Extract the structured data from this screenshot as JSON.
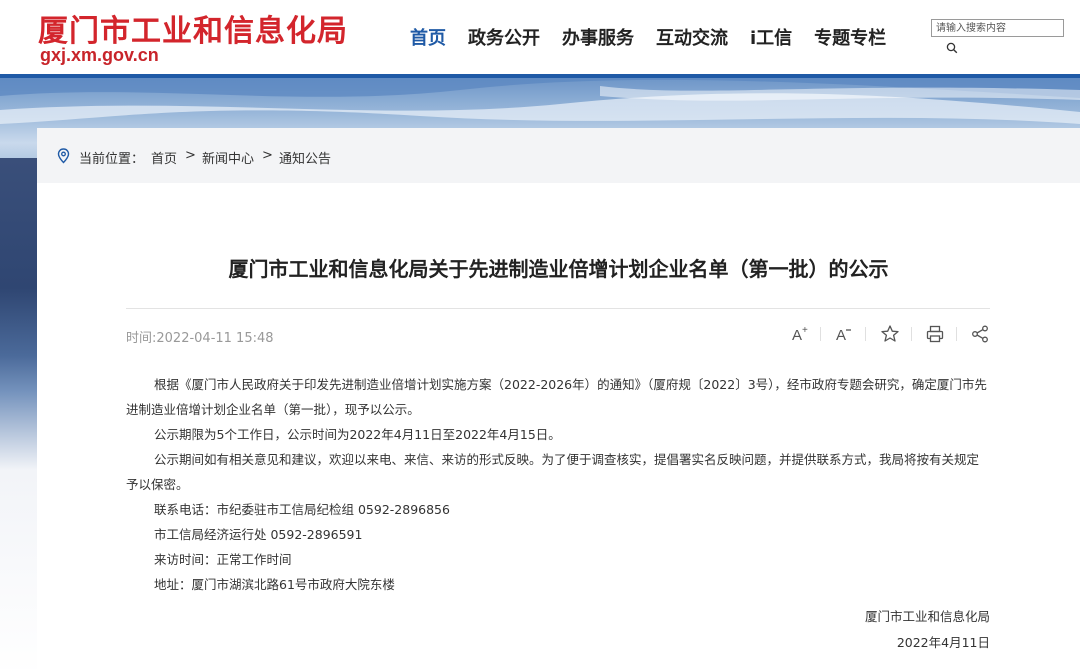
{
  "header": {
    "title": "厦门市工业和信息化局",
    "domain": "gxj.xm.gov.cn",
    "nav": [
      "首页",
      "政务公开",
      "办事服务",
      "互动交流",
      "i工信",
      "专题专栏"
    ],
    "search": {
      "placeholder": "请输入搜索内容"
    }
  },
  "breadcrumb": {
    "label": "当前位置：",
    "items": [
      "首页",
      "新闻中心",
      "通知公告"
    ],
    "separator": ">"
  },
  "article": {
    "title": "厦门市工业和信息化局关于先进制造业倍增计划企业名单（第一批）的公示",
    "time": "时间:2022-04-11 15:48",
    "paragraphs": [
      "根据《厦门市人民政府关于印发先进制造业倍增计划实施方案（2022-2026年）的通知》（厦府规〔2022〕3号），经市政府专题会研究，确定厦门市先进制造业倍增计划企业名单（第一批），现予以公示。",
      "公示期限为5个工作日，公示时间为2022年4月11日至2022年4月15日。",
      "公示期间如有相关意见和建议，欢迎以来电、来信、来访的形式反映。为了便于调查核实，提倡署实名反映问题，并提供联系方式，我局将按有关规定予以保密。"
    ],
    "contacts": [
      "联系电话：市纪委驻市工信局纪检组 0592-2896856",
      "市工信局经济运行处 0592-2896591",
      "来访时间：正常工作时间",
      "地址：厦门市湖滨北路61号市政府大院东楼"
    ],
    "signature": "厦门市工业和信息化局",
    "date": "2022年4月11日"
  },
  "toolbar": [
    "font-increase-icon",
    "font-decrease-icon",
    "star-icon",
    "print-icon",
    "share-icon"
  ],
  "colors": {
    "brand_red": "#d3252c",
    "nav_active": "#1f5aa6",
    "blue_bar": "#1f5aa6"
  }
}
